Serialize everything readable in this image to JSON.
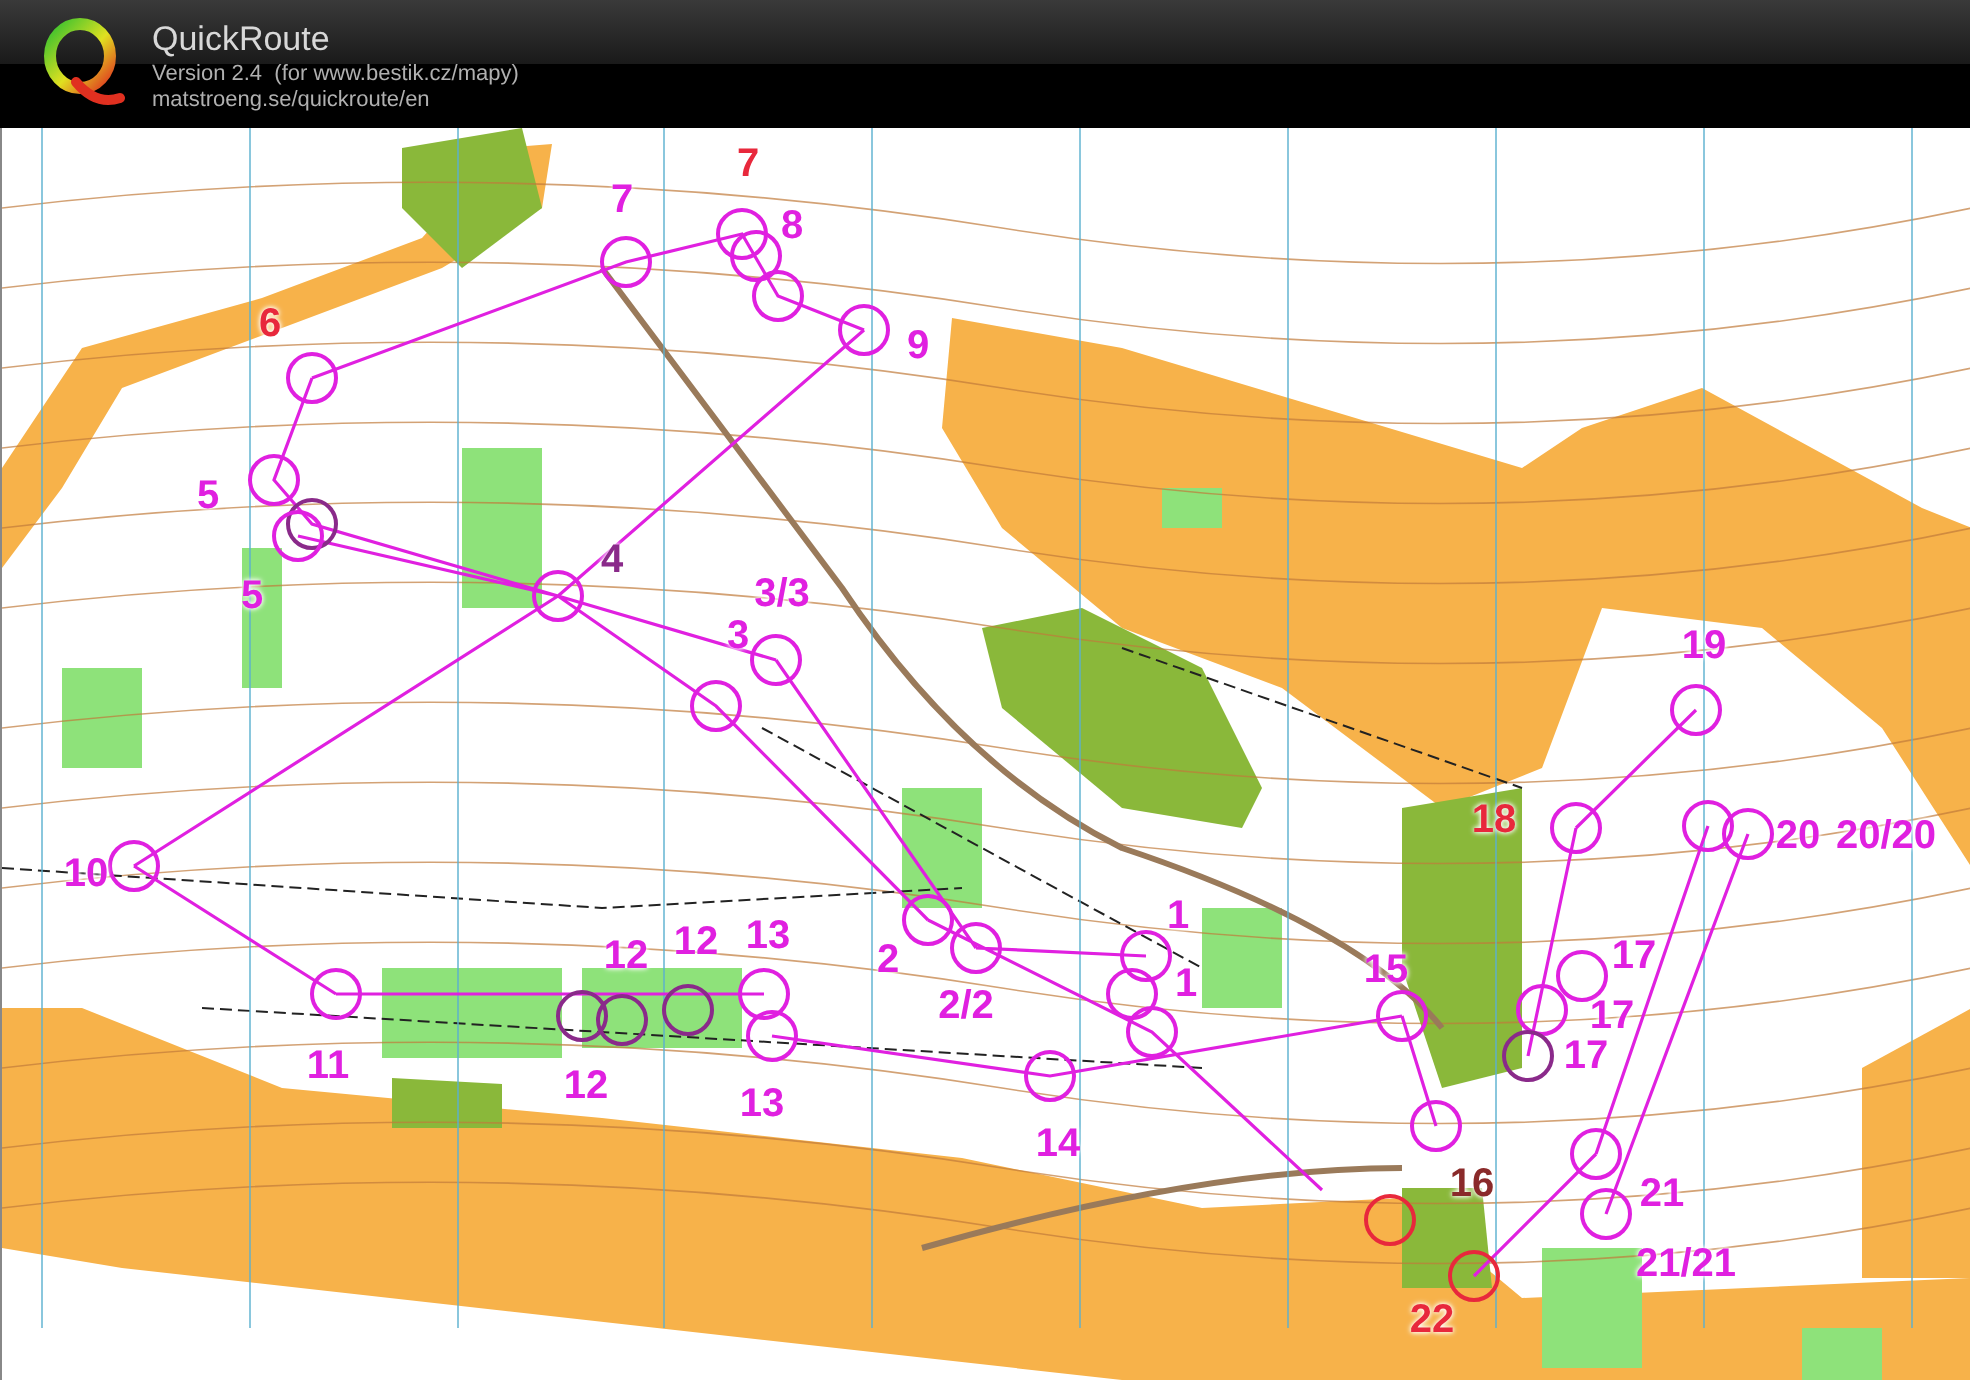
{
  "app": {
    "title": "QuickRoute",
    "version": "Version 2.4  (for www.bestik.cz/mapy)",
    "url": "matstroeng.se/quickroute/en"
  },
  "map": {
    "control_labels": [
      {
        "text": "7",
        "color": "#e8283c"
      },
      {
        "text": "7",
        "color": "#e020e0"
      },
      {
        "text": "8",
        "color": "#e020e0"
      },
      {
        "text": "9",
        "color": "#e020e0"
      },
      {
        "text": "6",
        "color": "#e8283c"
      },
      {
        "text": "5",
        "color": "#e020e0"
      },
      {
        "text": "5",
        "color": "#e020e0"
      },
      {
        "text": "4",
        "color": "#8a2a8a"
      },
      {
        "text": "3/3",
        "color": "#e020e0"
      },
      {
        "text": "3",
        "color": "#e020e0"
      },
      {
        "text": "10",
        "color": "#e020e0"
      },
      {
        "text": "2",
        "color": "#e020e0"
      },
      {
        "text": "2/2",
        "color": "#e020e0"
      },
      {
        "text": "1",
        "color": "#e020e0"
      },
      {
        "text": "1",
        "color": "#e020e0"
      },
      {
        "text": "12",
        "color": "#e020e0"
      },
      {
        "text": "12",
        "color": "#e020e0"
      },
      {
        "text": "13",
        "color": "#e020e0"
      },
      {
        "text": "11",
        "color": "#e020e0"
      },
      {
        "text": "12",
        "color": "#e020e0"
      },
      {
        "text": "13",
        "color": "#e020e0"
      },
      {
        "text": "14",
        "color": "#e020e0"
      },
      {
        "text": "15",
        "color": "#e020e0"
      },
      {
        "text": "16",
        "color": "#8a2a2a"
      },
      {
        "text": "18",
        "color": "#e8283c"
      },
      {
        "text": "17",
        "color": "#e020e0"
      },
      {
        "text": "17",
        "color": "#e020e0"
      },
      {
        "text": "17",
        "color": "#e020e0"
      },
      {
        "text": "19",
        "color": "#e020e0"
      },
      {
        "text": "20",
        "color": "#e020e0"
      },
      {
        "text": "20/20",
        "color": "#e020e0"
      },
      {
        "text": "21",
        "color": "#e020e0"
      },
      {
        "text": "21/21",
        "color": "#e020e0"
      },
      {
        "text": "22",
        "color": "#e8283c"
      }
    ]
  }
}
